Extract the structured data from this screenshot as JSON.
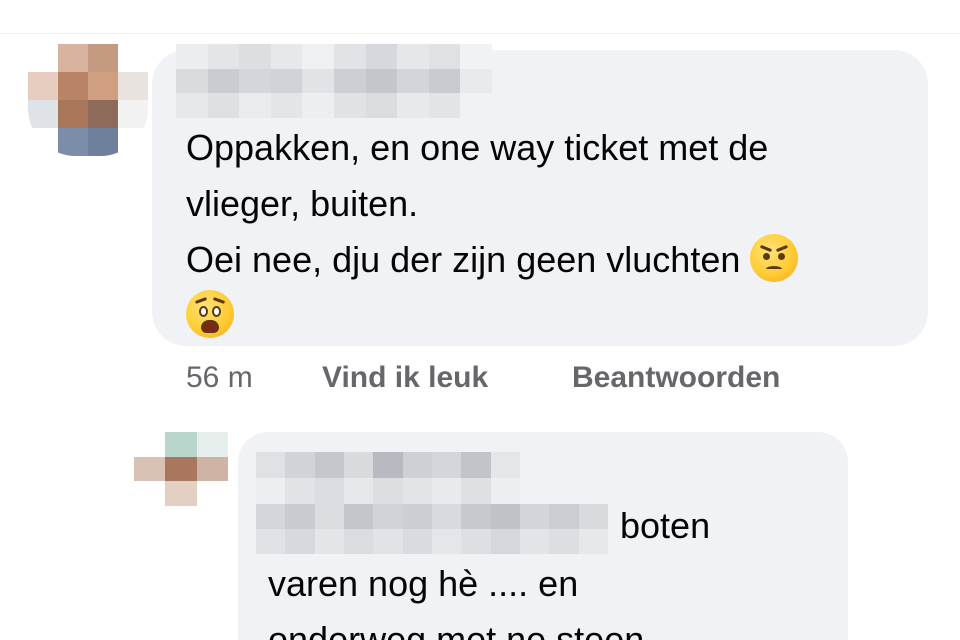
{
  "comment1": {
    "line1": "Oppakken, en one way ticket met de",
    "line2": "vlieger, buiten.",
    "line3": "Oei nee, dju der zijn geen vluchten",
    "emoji_after_line3": "angry-face-emoji",
    "emoji_line4": "anguished-face-emoji",
    "time": "56 m",
    "like_label": "Vind ik leuk",
    "reply_label": "Beantwoorden"
  },
  "reply1": {
    "line1_tail": "boten",
    "line2": "varen nog hè .... en",
    "line3": "onderweg met ne steen"
  },
  "colors": {
    "bubble_bg": "#f0f2f5",
    "meta_text": "#65676b",
    "body_text": "#050505"
  }
}
